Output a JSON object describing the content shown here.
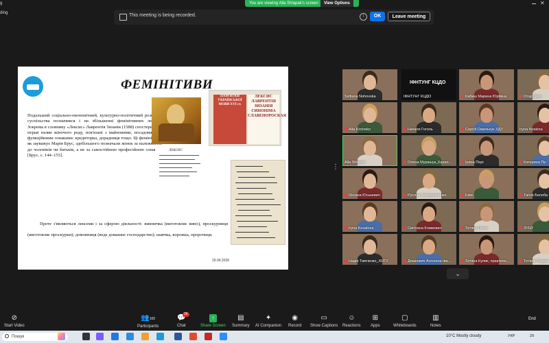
{
  "banner": {
    "viewing_text": "You are viewing Alla Shlapak's screen",
    "view_options": "View Options",
    "corner_top": "g",
    "corner_second": "ding"
  },
  "recording": {
    "text": "This meeting is being recorded.",
    "info_icon": "i",
    "ok_label": "OK",
    "leave_label": "Leave meeting"
  },
  "slide": {
    "title": "ФЕМІНІТИВИ",
    "paragraph1": "Подальший соціально-економічний, культурно-політичний розвиток суспільства позначився і на збільшенні фемінітивних лексем. Зокрема в словнику «Лексис» Лаврентія Зизанія (1588) спостережено перші назви жіночого роду, пов'язані з майновими, посадовими й функційними ознаками: кредиторка, дорадниця тощо. Ці фемінітиви, як зауважує Марія Брус, здебільшого позначали жінок за належністю до чоловіків чи батьків, а не за самостійною професійною ознакою [Брус, с. 144–155].",
    "paragraph2": "Проте з'являються лексеми і за сферою діяльності: винничка (виготовляє вино), проскурниця (виготовляє проскурки); домовниця (веде домашнє господарство); шавчка, ворожка, пророчиця.",
    "date": "29.04.2026",
    "book1_text": "ПАМ'ЯТКИ УКРАЇНСЬКОЇ МОВИ XVI ст.",
    "book2_text": "ЛЕКСИС ЛАВРЕНТІЯ ЗИЗАНІЯ СИНОНІМА СЛАВЕНОРОСКАЯ",
    "manuscript_label": "ЛЕКСИС"
  },
  "gallery": {
    "tiles": [
      {
        "name": "Svitlana Nohovska",
        "muted": false
      },
      {
        "name": "ІФНТУНГ КЦДО",
        "muted": false,
        "label": "ІФНТУНГ КЦДО"
      },
      {
        "name": "Кабиш Марина Юріївна",
        "muted": true
      },
      {
        "name": "Отар Доку",
        "muted": true
      },
      {
        "name": "Alla Kircheko",
        "muted": true
      },
      {
        "name": "Наталя Гоголь",
        "muted": true
      },
      {
        "name": "Сергій Омельчук ХДУ",
        "muted": true
      },
      {
        "name": "Iryna Noskina",
        "muted": false
      },
      {
        "name": "Alla Shlapak",
        "muted": false
      },
      {
        "name": "Олена Мурашук_Карап...",
        "muted": true
      },
      {
        "name": "Ірина Пері",
        "muted": true
      },
      {
        "name": "Катерина Пр",
        "muted": true
      },
      {
        "name": "Оксана Юськевич",
        "muted": true
      },
      {
        "name": "Руслан Запорожченко",
        "muted": true
      },
      {
        "name": "Fate",
        "muted": true
      },
      {
        "name": "Таїсія Белоба",
        "muted": true
      },
      {
        "name": "Iryna Kovalova",
        "muted": true
      },
      {
        "name": "Світлана Климович",
        "muted": true
      },
      {
        "name": "Тетяна Нила",
        "muted": true
      },
      {
        "name": "ЗУНУ",
        "muted": true
      },
      {
        "name": "Надія Тимченко_ХНТУ",
        "muted": true
      },
      {
        "name": "Дяшкевич Антоніна Іва...",
        "muted": true
      },
      {
        "name": "Тетяна Кулик, практичн...",
        "muted": true
      },
      {
        "name": "Тетяна Гордон",
        "muted": true
      }
    ]
  },
  "toolbar": {
    "start_video": "Start Video",
    "participants": "Participants",
    "participants_count": "100",
    "chat": "Chat",
    "chat_badge": "26",
    "share_screen": "Share Screen",
    "summary": "Summary",
    "ai_companion": "AI Companion",
    "record": "Record",
    "show_captions": "Show Captions",
    "reactions": "Reactions",
    "apps": "Apps",
    "whiteboards": "Whiteboards",
    "notes": "Notes",
    "end": "End"
  },
  "taskbar": {
    "search_placeholder": "Пошук",
    "weather": "10°C  Mostly cloudy",
    "language": "УКР",
    "clock": "29"
  },
  "colors": {
    "share_green": "#2eb05a",
    "ok_blue": "#0e72ed",
    "muted_red": "#e04343",
    "active_speaker": "#4cd964"
  }
}
